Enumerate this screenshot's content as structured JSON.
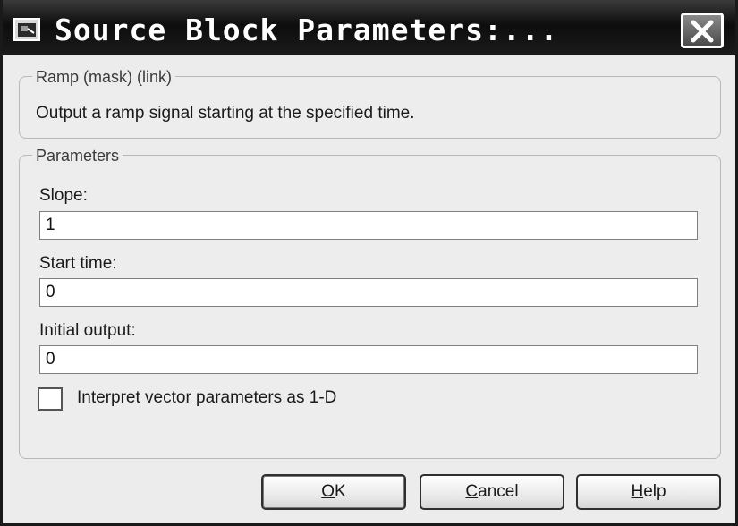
{
  "window": {
    "title": "Source Block Parameters:...",
    "app_icon": "simulink-block-icon",
    "close_icon": "close-icon"
  },
  "description_group": {
    "legend": "Ramp (mask) (link)",
    "text": "Output a ramp signal starting at the specified time."
  },
  "parameters_group": {
    "legend": "Parameters",
    "slope": {
      "label": "Slope:",
      "value": "1"
    },
    "start_time": {
      "label": "Start time:",
      "value": "0"
    },
    "initial_output": {
      "label": "Initial output:",
      "value": "0"
    },
    "interpret_checkbox": {
      "label": "Interpret vector parameters as 1-D",
      "checked": false
    }
  },
  "buttons": {
    "ok_mnemonic": "O",
    "ok_rest": "K",
    "cancel_mnemonic": "C",
    "cancel_rest": "ancel",
    "help_mnemonic": "H",
    "help_rest": "elp"
  }
}
